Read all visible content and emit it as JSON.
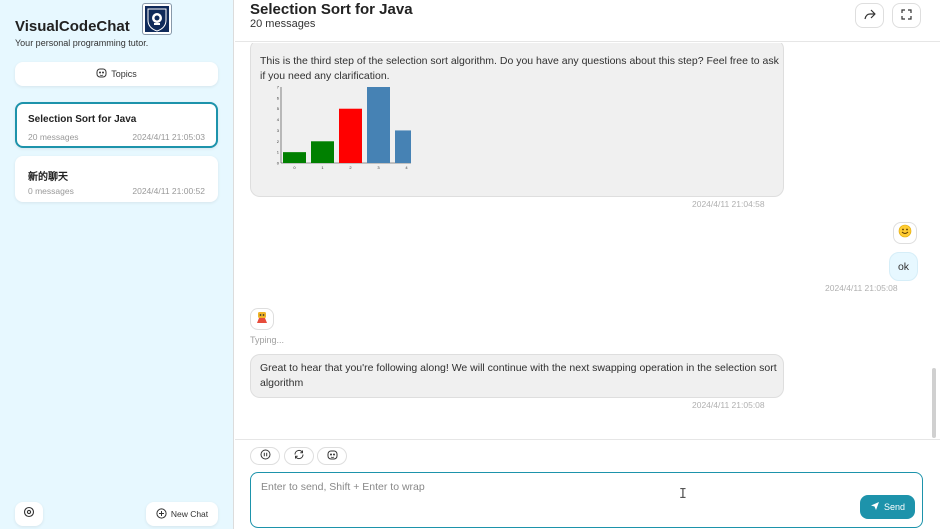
{
  "sidebar": {
    "brand": "VisualCodeChat",
    "tagline": "Your personal programming tutor.",
    "topics_label": "Topics",
    "chats": [
      {
        "title": "Selection Sort for Java",
        "count": "20 messages",
        "time": "2024/4/11 21:05:03",
        "active": true
      },
      {
        "title": "新的聊天",
        "count": "0 messages",
        "time": "2024/4/11 21:00:52",
        "active": false
      }
    ],
    "new_chat_label": "New Chat"
  },
  "header": {
    "title": "Selection Sort for Java",
    "subtitle": "20 messages"
  },
  "messages": [
    {
      "role": "bot",
      "text": "This is the third step of the selection sort algorithm. Do you have any questions about this step? Feel free to ask if you need any clarification.",
      "time": "2024/4/11 21:04:58"
    },
    {
      "role": "user",
      "avatar_icon": "smiley-emoji-icon",
      "text": "ok",
      "time": "2024/4/11 21:05:08"
    },
    {
      "role": "bot",
      "avatar_icon": "robot-emoji-icon",
      "status": "Typing...",
      "text": "Great to hear that you're following along! We will continue with the next swapping operation in the selection sort algorithm",
      "time": "2024/4/11 21:05:08"
    }
  ],
  "chart_data": {
    "type": "bar",
    "categories": [
      "0",
      "1",
      "2",
      "3",
      "4"
    ],
    "values": [
      1,
      2,
      5,
      7,
      3
    ],
    "colors": [
      "#008000",
      "#008000",
      "#ff0000",
      "#4682b4",
      "#4682b4"
    ],
    "ylim": [
      0,
      7
    ],
    "yticks": [
      "0",
      "1",
      "2",
      "3",
      "4",
      "5",
      "6",
      "7"
    ]
  },
  "input": {
    "placeholder": "Enter to send, Shift + Enter to wrap",
    "send_label": "Send"
  },
  "colors": {
    "accent": "#1d93ab",
    "sidebar_bg": "#e7f8ff",
    "bubble_bg": "#f0f0f0"
  }
}
